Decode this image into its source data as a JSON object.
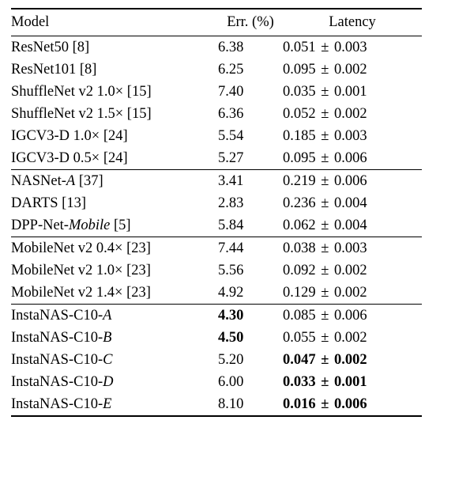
{
  "chart_data": {
    "type": "table",
    "title": "",
    "columns": [
      "Model",
      "Err. (%)",
      "Latency"
    ],
    "groups": [
      {
        "rows": [
          {
            "model": "ResNet50",
            "ref": "[8]",
            "err": "6.38",
            "lat_mean": "0.051",
            "lat_std": "0.003",
            "err_bold": false,
            "lat_bold": false
          },
          {
            "model": "ResNet101",
            "ref": "[8]",
            "err": "6.25",
            "lat_mean": "0.095",
            "lat_std": "0.002",
            "err_bold": false,
            "lat_bold": false
          },
          {
            "model": "ShuffleNet v2 1.0×",
            "ref": "[15]",
            "err": "7.40",
            "lat_mean": "0.035",
            "lat_std": "0.001",
            "err_bold": false,
            "lat_bold": false
          },
          {
            "model": "ShuffleNet v2 1.5×",
            "ref": "[15]",
            "err": "6.36",
            "lat_mean": "0.052",
            "lat_std": "0.002",
            "err_bold": false,
            "lat_bold": false
          },
          {
            "model": "IGCV3-D 1.0×",
            "ref": "[24]",
            "err": "5.54",
            "lat_mean": "0.185",
            "lat_std": "0.003",
            "err_bold": false,
            "lat_bold": false
          },
          {
            "model": "IGCV3-D 0.5×",
            "ref": "[24]",
            "err": "5.27",
            "lat_mean": "0.095",
            "lat_std": "0.006",
            "err_bold": false,
            "lat_bold": false
          }
        ]
      },
      {
        "rows": [
          {
            "model": "NASNet-",
            "suffix_it": "A",
            "ref": "[37]",
            "err": "3.41",
            "lat_mean": "0.219",
            "lat_std": "0.006",
            "err_bold": false,
            "lat_bold": false
          },
          {
            "model": "DARTS",
            "ref": "[13]",
            "err": "2.83",
            "lat_mean": "0.236",
            "lat_std": "0.004",
            "err_bold": false,
            "lat_bold": false
          },
          {
            "model": "DPP-Net-",
            "suffix_it": "Mobile",
            "ref": "[5]",
            "err": "5.84",
            "lat_mean": "0.062",
            "lat_std": "0.004",
            "err_bold": false,
            "lat_bold": false
          }
        ]
      },
      {
        "rows": [
          {
            "model": "MobileNet v2 0.4×",
            "ref": "[23]",
            "err": "7.44",
            "lat_mean": "0.038",
            "lat_std": "0.003",
            "err_bold": false,
            "lat_bold": false
          },
          {
            "model": "MobileNet v2 1.0×",
            "ref": "[23]",
            "err": "5.56",
            "lat_mean": "0.092",
            "lat_std": "0.002",
            "err_bold": false,
            "lat_bold": false
          },
          {
            "model": "MobileNet v2 1.4×",
            "ref": "[23]",
            "err": "4.92",
            "lat_mean": "0.129",
            "lat_std": "0.002",
            "err_bold": false,
            "lat_bold": false
          }
        ]
      },
      {
        "rows": [
          {
            "model": "InstaNAS-C10-",
            "suffix_it": "A",
            "err": "4.30",
            "lat_mean": "0.085",
            "lat_std": "0.006",
            "err_bold": true,
            "lat_bold": false
          },
          {
            "model": "InstaNAS-C10-",
            "suffix_it": "B",
            "err": "4.50",
            "lat_mean": "0.055",
            "lat_std": "0.002",
            "err_bold": true,
            "lat_bold": false
          },
          {
            "model": "InstaNAS-C10-",
            "suffix_it": "C",
            "err": "5.20",
            "lat_mean": "0.047",
            "lat_std": "0.002",
            "err_bold": false,
            "lat_bold": true
          },
          {
            "model": "InstaNAS-C10-",
            "suffix_it": "D",
            "err": "6.00",
            "lat_mean": "0.033",
            "lat_std": "0.001",
            "err_bold": false,
            "lat_bold": true
          },
          {
            "model": "InstaNAS-C10-",
            "suffix_it": "E",
            "err": "8.10",
            "lat_mean": "0.016",
            "lat_std": "0.006",
            "err_bold": false,
            "lat_bold": true
          }
        ]
      }
    ]
  },
  "header": {
    "model": "Model",
    "err": "Err. (%)",
    "lat": "Latency"
  },
  "sym": {
    "pm": "±"
  }
}
